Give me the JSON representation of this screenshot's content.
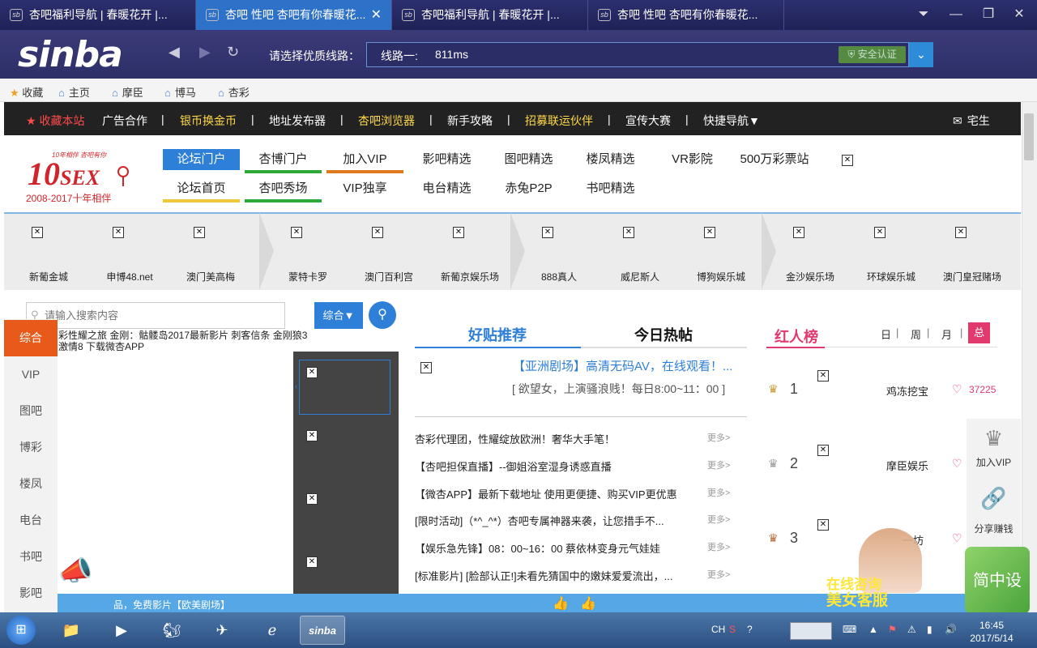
{
  "browser": {
    "tabs": [
      {
        "title": "杏吧福利导航 | 春暖花开 |...",
        "active": false
      },
      {
        "title": "杏吧 性吧 杏吧有你春暖花...",
        "active": true
      },
      {
        "title": "杏吧福利导航 | 春暖花开 |...",
        "active": false
      },
      {
        "title": "杏吧 性吧 杏吧有你春暖花...",
        "active": false
      }
    ],
    "logo": "sinba",
    "line_prompt": "请选择优质线路：",
    "address_line": "线路一:",
    "address_ms": "811ms",
    "secure_label": "安全认证",
    "bookmarks": [
      "收藏",
      "主页",
      "摩臣",
      "博马",
      "杏彩"
    ]
  },
  "site_bar": {
    "items": [
      "收藏本站",
      "广告合作",
      "银币换金币",
      "地址发布器",
      "杏吧浏览器",
      "新手攻略",
      "招募联运伙伴",
      "宣传大赛",
      "快捷导航"
    ],
    "right_label": "宅生"
  },
  "site_logo": {
    "top": "10年相伴 杏吧有你",
    "mark": "10SEX",
    "years": "2008-2017十年相伴"
  },
  "header_nav": {
    "row1": [
      "论坛门户",
      "杏博门户",
      "加入VIP",
      "影吧精选",
      "图吧精选",
      "楼凤精选",
      "VR影院",
      "500万彩票站"
    ],
    "row2": [
      "论坛首页",
      "杏吧秀场",
      "VIP独享",
      "电台精选",
      "赤兔P2P",
      "书吧精选"
    ]
  },
  "casinos": [
    "新葡金城",
    "申博48.net",
    "澳门美高梅",
    "蒙特卡罗",
    "澳门百利宫",
    "新葡京娱乐场",
    "888真人",
    "威尼斯人",
    "博狗娱乐城",
    "金沙娱乐场",
    "环球娱乐城",
    "澳门皇冠赌场"
  ],
  "search": {
    "placeholder": "请输入搜索内容",
    "scope": "综合"
  },
  "side_nav": [
    "综合",
    "VIP",
    "图吧",
    "博彩",
    "楼凤",
    "电台",
    "书吧",
    "影吧"
  ],
  "hot_tags": "彩性耀之旅 金刚：骷髅岛2017最新影片 刺客信条 金刚狼3 激情8 下载微杏APP",
  "middle": {
    "tabs": [
      "好贴推荐",
      "今日热帖"
    ],
    "featured_title": "【亚洲剧场】高清无码AV，在线观看！...",
    "featured_sub": "[ 欲望女，上演骚浪贱！每日8:00~11：00 ]",
    "news": [
      "杏彩代理团，性耀绽放欧洲！奢华大手笔！",
      "【杏吧担保直播】--御姐浴室湿身诱惑直播",
      "【微杏APP】最新下载地址 使用更便捷、购买VIP更优惠",
      "[限时活动]（*^_^*）杏吧专属神器来袭，让您措手不...",
      "【娱乐急先锋】08：00~16：00 蔡依林变身元气娃娃",
      "[标准影片] [脸部认正!]未看先猜国中的嫩妹爱爱流出，..."
    ],
    "more": "更多>"
  },
  "rank": {
    "title": "红人榜",
    "periods": [
      "日",
      "周",
      "月",
      "总"
    ],
    "entries": [
      {
        "rank": "1",
        "name": "鸡冻挖宝",
        "likes": "37225"
      },
      {
        "rank": "2",
        "name": "摩臣娱乐",
        "likes": ""
      },
      {
        "rank": "3",
        "name": "一坊",
        "likes": ""
      }
    ]
  },
  "float_panel": [
    "加入VIP",
    "分享赚钱"
  ],
  "bottom_bar": "品，免费影片【欧美剧场】",
  "ads": {
    "girl_text1": "在线咨询",
    "girl_text2": "美女客服",
    "green_text": "简中设"
  },
  "taskbar": {
    "time": "16:45",
    "date": "2017/5/14",
    "lang": "CH"
  }
}
